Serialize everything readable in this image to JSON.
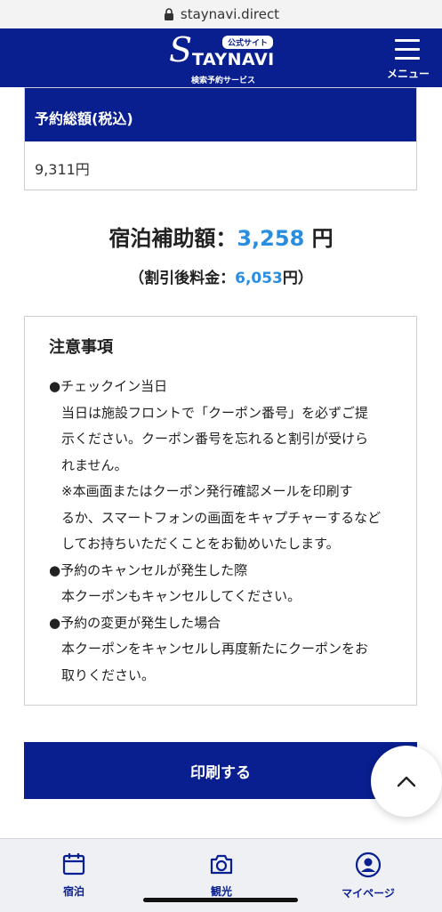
{
  "browser": {
    "url": "staynavi.direct"
  },
  "header": {
    "logo_badge": "公式サイト",
    "logo_s": "S",
    "logo_word": "TAYNAVI",
    "logo_sub": "検索予約サービス",
    "menu_label": "メニュー"
  },
  "total": {
    "heading": "予約総額(税込)",
    "value": "9,311円"
  },
  "subsidy": {
    "label": "宿泊補助額：",
    "amount": "3,258",
    "unit": " 円"
  },
  "after_discount": {
    "prefix": "（割引後料金：",
    "amount": "6,053",
    "suffix": "円）"
  },
  "notes": {
    "title": "注意事項",
    "lines": [
      "●チェックイン当日",
      "当日は施設フロントで「クーポン番号」を必ずご提",
      "示ください。クーポン番号を忘れると割引が受けら",
      "れません。",
      "※本画面またはクーポン発行確認メールを印刷す",
      "るか、スマートフォンの画面をキャプチャーするなど",
      "してお持ちいただくことをお勧めいたします。",
      "●予約のキャンセルが発生した際",
      "本クーポンもキャンセルしてください。",
      "●予約の変更が発生した場合",
      "本クーポンをキャンセルし再度新たにクーポンをお",
      "取りください。"
    ]
  },
  "print_button": "印刷する",
  "tabs": [
    {
      "label": "宿泊",
      "icon": "calendar-icon"
    },
    {
      "label": "観光",
      "icon": "camera-icon"
    },
    {
      "label": "マイページ",
      "icon": "user-icon"
    }
  ],
  "colors": {
    "brand": "#0a1f8f",
    "accent": "#2a8ee0"
  }
}
